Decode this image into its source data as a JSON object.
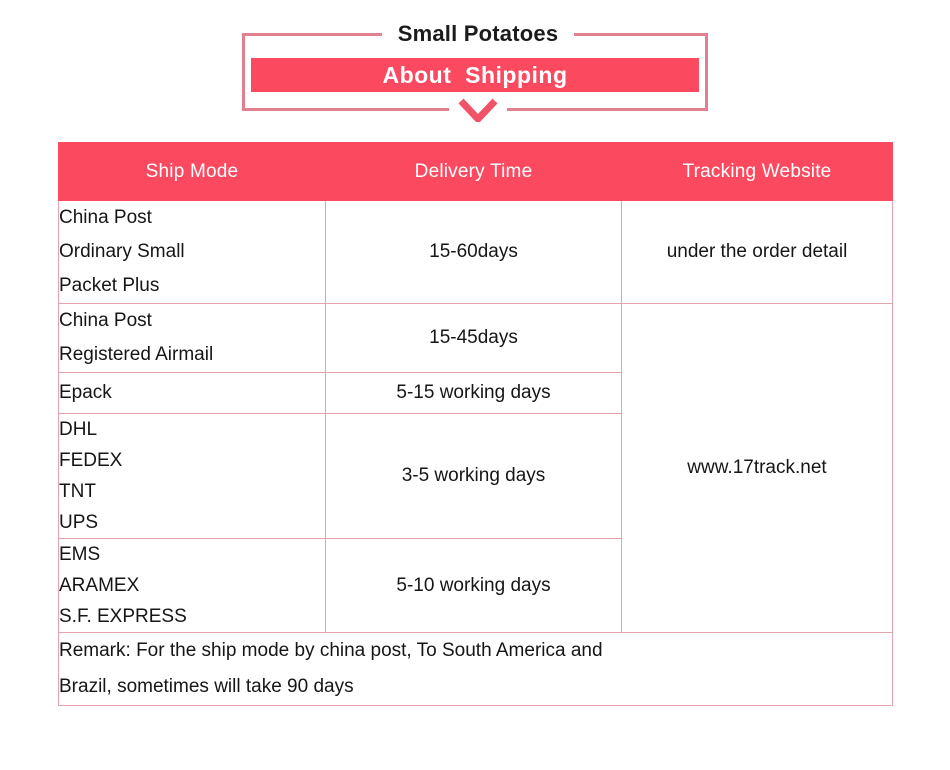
{
  "header": {
    "brand": "Small Potatoes",
    "banner_title": "About  Shipping",
    "chevron_icon": "chevron-down-icon",
    "accent_color": "#fb4a60",
    "box_border_color": "#e2808f"
  },
  "table": {
    "border_color": "#e7a2ae",
    "header_bg": "#fb4a60",
    "columns": [
      {
        "label": "Ship Mode"
      },
      {
        "label": "Delivery Time"
      },
      {
        "label": "Tracking Website"
      }
    ],
    "rows": [
      {
        "mode_lines": [
          "China Post",
          "Ordinary Small",
          "Packet Plus"
        ],
        "delivery_time": "15-60days",
        "tracking": "under the order detail"
      },
      {
        "mode_lines": [
          "China Post",
          "Registered Airmail"
        ],
        "delivery_time": "15-45days",
        "tracking": "www.17track.net"
      },
      {
        "mode_lines": [
          "Epack"
        ],
        "delivery_time": "5-15 working days",
        "tracking": ""
      },
      {
        "mode_lines": [
          "DHL",
          "FEDEX",
          "TNT",
          "UPS"
        ],
        "delivery_time": "3-5 working days",
        "tracking": ""
      },
      {
        "mode_lines": [
          "EMS",
          "ARAMEX",
          "S.F. EXPRESS"
        ],
        "delivery_time": "5-10 working days",
        "tracking": ""
      }
    ],
    "remark_lines": [
      "Remark: For the ship mode by china post, To South America and",
      "Brazil, sometimes will take 90 days"
    ]
  }
}
